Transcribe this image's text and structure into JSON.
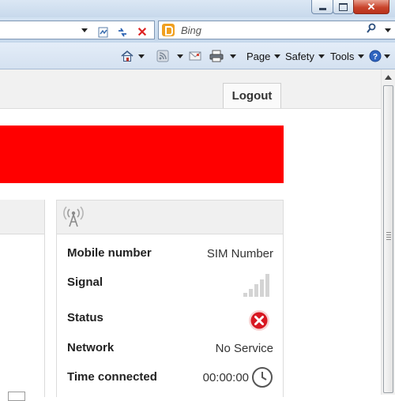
{
  "browser": {
    "search": {
      "placeholder": "Bing"
    },
    "command_bar": {
      "page_label": "Page",
      "safety_label": "Safety",
      "tools_label": "Tools"
    }
  },
  "header": {
    "logout_label": "Logout"
  },
  "colors": {
    "banner": "#ff0000",
    "status_error": "#d81822"
  },
  "connection_panel": {
    "mobile_number_label": "Mobile number",
    "mobile_number_value": "SIM Number",
    "signal_label": "Signal",
    "signal_bars": 0,
    "status_label": "Status",
    "status_icon": "error-x-icon",
    "network_label": "Network",
    "network_value": "No Service",
    "time_connected_label": "Time connected",
    "time_connected_value": "00:00:00"
  }
}
